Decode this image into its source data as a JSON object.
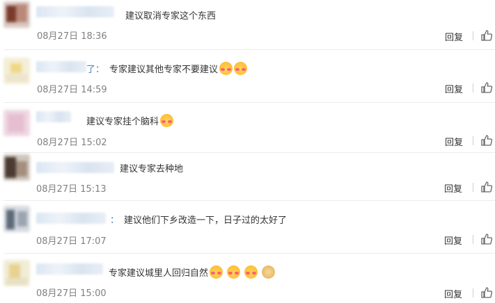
{
  "comments": [
    {
      "text": "建议取消专家这个东西",
      "time": "08月27日 18:36",
      "name_suffix": "",
      "emojis": []
    },
    {
      "text": "专家建议其他专家不要建议",
      "time": "08月27日 14:59",
      "name_suffix": "了：",
      "emojis": [
        "blush-emoji",
        "blush-emoji"
      ]
    },
    {
      "text": "建议专家挂个脑科",
      "time": "08月27日 15:02",
      "name_suffix": "",
      "emojis": [
        "blush-emoji"
      ]
    },
    {
      "text": "建议专家去种地",
      "time": "08月27日 15:13",
      "name_suffix": "",
      "emojis": []
    },
    {
      "text": "建议他们下乡改造一下，日子过的太好了",
      "time": "08月27日 17:07",
      "name_suffix": "：",
      "emojis": []
    },
    {
      "text": "专家建议城里人回归自然",
      "time": "08月27日 15:00",
      "name_suffix": "",
      "emojis": [
        "blush-emoji",
        "blush-emoji",
        "blush-emoji",
        "doge-emoji"
      ]
    }
  ],
  "actions": {
    "reply_label": "回复",
    "like_icon": "thumbs-up-icon"
  },
  "colors": {
    "link": "#4d7fc0",
    "muted": "#808080",
    "divider": "#ececec"
  }
}
